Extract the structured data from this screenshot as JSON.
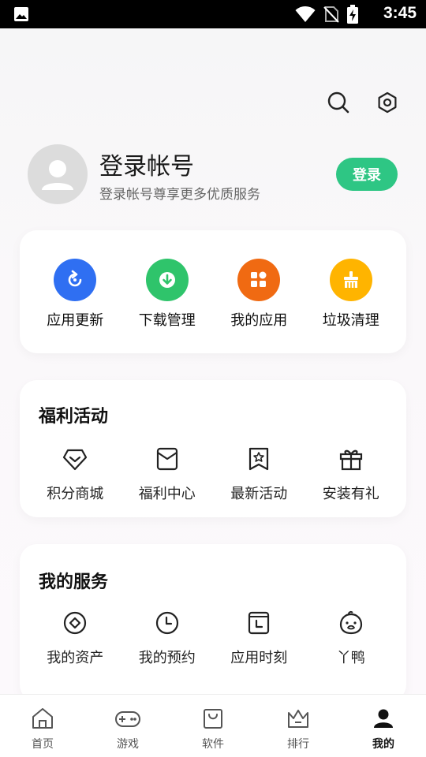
{
  "status_bar": {
    "time": "3:45"
  },
  "header": {
    "search_icon": "search-icon",
    "settings_icon": "settings-hexagon-icon"
  },
  "profile": {
    "title": "登录帐号",
    "subtitle": "登录帐号尊享更多优质服务",
    "login_button": "登录"
  },
  "quick_actions": [
    {
      "label": "应用更新",
      "icon": "refresh-icon",
      "color": "#2f6ff2"
    },
    {
      "label": "下载管理",
      "icon": "download-icon",
      "color": "#2fc46b"
    },
    {
      "label": "我的应用",
      "icon": "apps-icon",
      "color": "#f06a12"
    },
    {
      "label": "垃圾清理",
      "icon": "broom-icon",
      "color": "#ffb400"
    }
  ],
  "welfare": {
    "title": "福利活动",
    "items": [
      {
        "label": "积分商城",
        "icon": "diamond-icon"
      },
      {
        "label": "福利中心",
        "icon": "envelope-icon"
      },
      {
        "label": "最新活动",
        "icon": "bookmark-star-icon"
      },
      {
        "label": "安装有礼",
        "icon": "gift-icon"
      }
    ]
  },
  "services": {
    "title": "我的服务",
    "items": [
      {
        "label": "我的资产",
        "icon": "asset-coin-icon"
      },
      {
        "label": "我的预约",
        "icon": "clock-icon"
      },
      {
        "label": "应用时刻",
        "icon": "app-time-icon"
      },
      {
        "label": "丫鸭",
        "icon": "duck-icon"
      }
    ]
  },
  "bottom_nav": [
    {
      "label": "首页",
      "icon": "home-icon",
      "active": false
    },
    {
      "label": "游戏",
      "icon": "gamepad-icon",
      "active": false
    },
    {
      "label": "软件",
      "icon": "bag-icon",
      "active": false
    },
    {
      "label": "排行",
      "icon": "crown-icon",
      "active": false
    },
    {
      "label": "我的",
      "icon": "person-icon",
      "active": true
    }
  ]
}
